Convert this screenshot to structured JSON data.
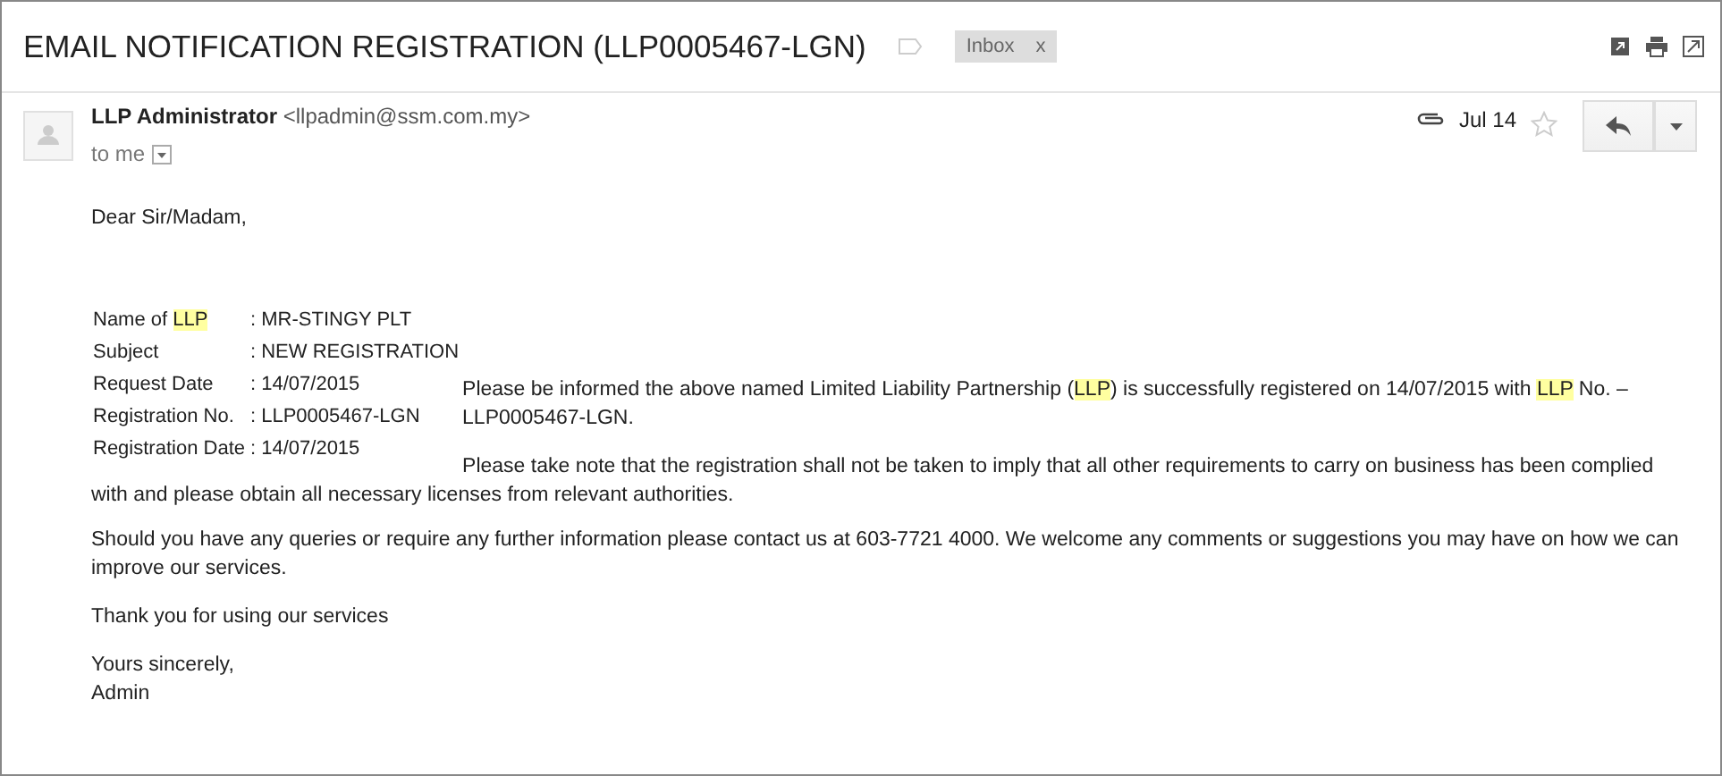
{
  "subject": "EMAIL NOTIFICATION REGISTRATION (LLP0005467-LGN)",
  "labels": [
    {
      "label": "Inbox",
      "remove": "x"
    }
  ],
  "sender": {
    "name": "LLP Administrator",
    "email": "<llpadmin@ssm.com.my>",
    "to": "to me",
    "date": "Jul 14",
    "starred": false,
    "has_attachment": true
  },
  "greeting": "Dear Sir/Madam,",
  "details": [
    {
      "label": [
        {
          "text": "Name of ",
          "highlight": false
        },
        {
          "text": "LLP",
          "highlight": true
        }
      ],
      "value": ": MR-STINGY PLT"
    },
    {
      "label": [
        {
          "text": "Subject",
          "highlight": false
        }
      ],
      "value": ": NEW REGISTRATION"
    },
    {
      "label": [
        {
          "text": "Request Date",
          "highlight": false
        }
      ],
      "value": ": 14/07/2015"
    },
    {
      "label": [
        {
          "text": "Registration No.",
          "highlight": false
        }
      ],
      "value": ": LLP0005467-LGN"
    },
    {
      "label": [
        {
          "text": "Registration Date",
          "highlight": false
        }
      ],
      "value": ": 14/07/2015"
    }
  ],
  "paragraphs": [
    [
      {
        "text": "Please be informed the above named Limited Liability Partnership (",
        "highlight": false
      },
      {
        "text": "LLP",
        "highlight": true
      },
      {
        "text": ") is successfully registered on 14/07/2015 with ",
        "highlight": false
      },
      {
        "text": "LLP",
        "highlight": true
      },
      {
        "text": " No. – LLP0005467-LGN.",
        "highlight": false
      }
    ],
    [
      {
        "text": "Please take note that the registration shall not be taken to imply that all other requirements to carry on business has been complied with and please obtain all necessary licenses from relevant authorities.",
        "highlight": false
      }
    ],
    [
      {
        "text": "Should you have any queries or require any further information please contact us at 603-7721 4000. We welcome any comments or suggestions you may have on how we can improve our services.",
        "highlight": false
      }
    ],
    [
      {
        "text": "Thank you for using our services",
        "highlight": false
      }
    ]
  ],
  "closing": [
    "Yours sincerely,",
    "Admin"
  ]
}
